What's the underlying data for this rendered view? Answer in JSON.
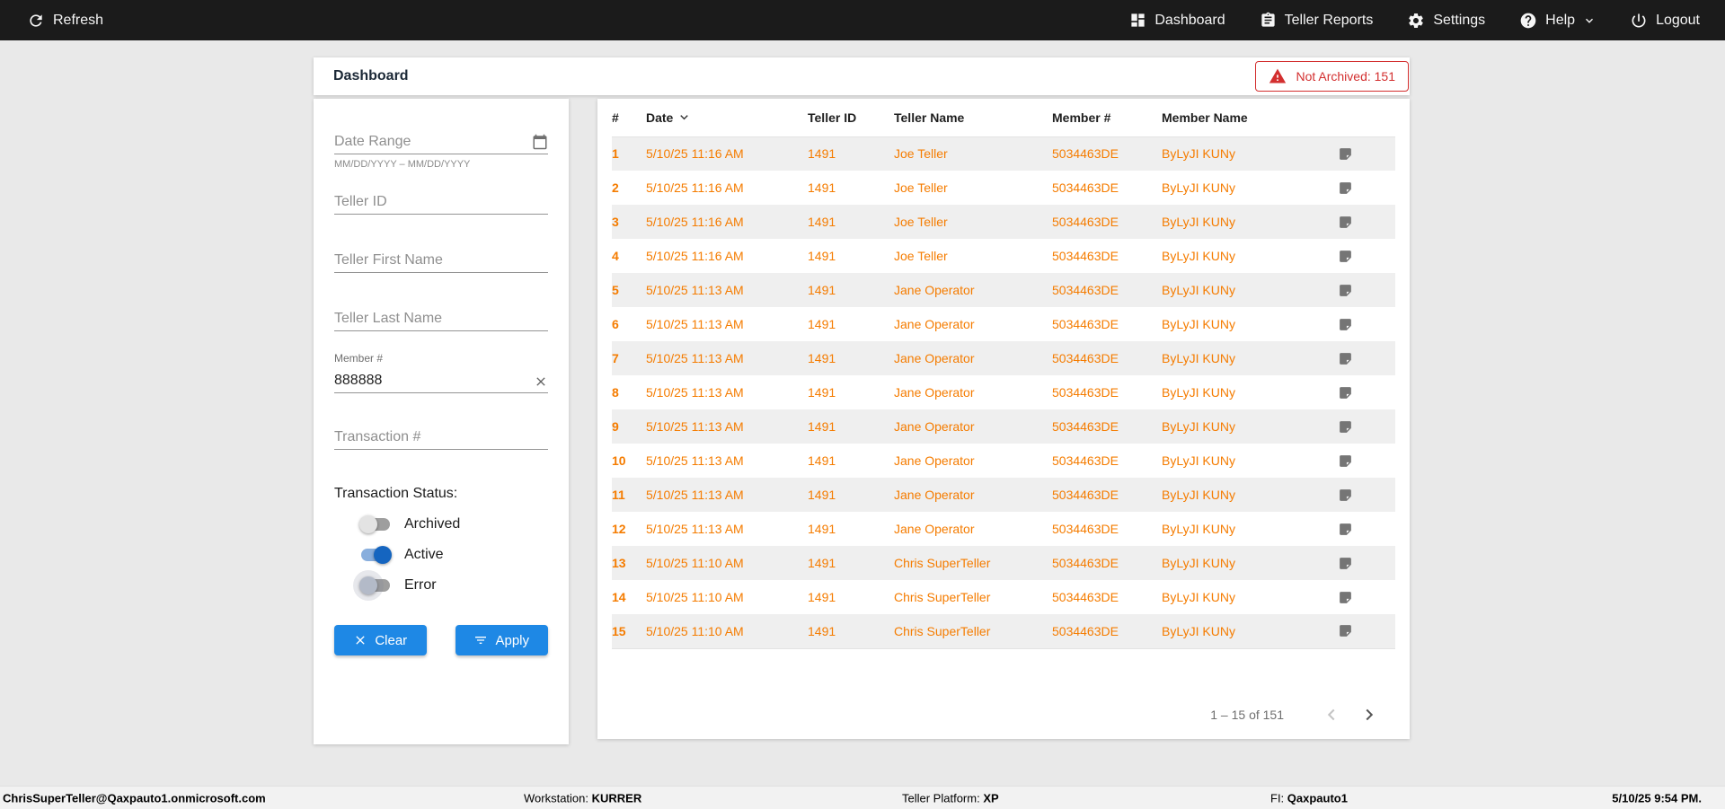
{
  "topbar": {
    "refresh_label": "Refresh",
    "nav": [
      {
        "label": "Dashboard",
        "icon": "dashboard-icon"
      },
      {
        "label": "Teller Reports",
        "icon": "teller-reports-icon"
      },
      {
        "label": "Settings",
        "icon": "gear-icon"
      },
      {
        "label": "Help",
        "icon": "help-icon"
      },
      {
        "label": "Logout",
        "icon": "power-icon"
      }
    ]
  },
  "header": {
    "title": "Dashboard",
    "not_archived": "Not Archived: 151"
  },
  "filters": {
    "date_range_placeholder": "Date Range",
    "date_range_hint": "MM/DD/YYYY – MM/DD/YYYY",
    "teller_id_placeholder": "Teller ID",
    "teller_first_name_placeholder": "Teller First Name",
    "teller_last_name_placeholder": "Teller Last Name",
    "member_number_label": "Member #",
    "member_number_value": "888888",
    "transaction_number_placeholder": "Transaction #",
    "status_label": "Transaction Status:",
    "toggles": [
      {
        "label": "Archived",
        "on": false
      },
      {
        "label": "Active",
        "on": true
      },
      {
        "label": "Error",
        "on": false
      }
    ],
    "clear_label": "Clear",
    "apply_label": "Apply"
  },
  "table": {
    "columns": [
      "#",
      "Date",
      "Teller ID",
      "Teller Name",
      "Member #",
      "Member Name"
    ],
    "rows": [
      {
        "num": "1",
        "date": "5/10/25 11:16 AM",
        "teller_id": "1491",
        "teller_name": "Joe Teller",
        "member_number": "5034463DE",
        "member_name": "ByLyJI KUNy"
      },
      {
        "num": "2",
        "date": "5/10/25 11:16 AM",
        "teller_id": "1491",
        "teller_name": "Joe Teller",
        "member_number": "5034463DE",
        "member_name": "ByLyJI KUNy"
      },
      {
        "num": "3",
        "date": "5/10/25 11:16 AM",
        "teller_id": "1491",
        "teller_name": "Joe Teller",
        "member_number": "5034463DE",
        "member_name": "ByLyJI KUNy"
      },
      {
        "num": "4",
        "date": "5/10/25 11:16 AM",
        "teller_id": "1491",
        "teller_name": "Joe Teller",
        "member_number": "5034463DE",
        "member_name": "ByLyJI KUNy"
      },
      {
        "num": "5",
        "date": "5/10/25 11:13 AM",
        "teller_id": "1491",
        "teller_name": "Jane Operator",
        "member_number": "5034463DE",
        "member_name": "ByLyJI KUNy"
      },
      {
        "num": "6",
        "date": "5/10/25 11:13 AM",
        "teller_id": "1491",
        "teller_name": "Jane Operator",
        "member_number": "5034463DE",
        "member_name": "ByLyJI KUNy"
      },
      {
        "num": "7",
        "date": "5/10/25 11:13 AM",
        "teller_id": "1491",
        "teller_name": "Jane Operator",
        "member_number": "5034463DE",
        "member_name": "ByLyJI KUNy"
      },
      {
        "num": "8",
        "date": "5/10/25 11:13 AM",
        "teller_id": "1491",
        "teller_name": "Jane Operator",
        "member_number": "5034463DE",
        "member_name": "ByLyJI KUNy"
      },
      {
        "num": "9",
        "date": "5/10/25 11:13 AM",
        "teller_id": "1491",
        "teller_name": "Jane Operator",
        "member_number": "5034463DE",
        "member_name": "ByLyJI KUNy"
      },
      {
        "num": "10",
        "date": "5/10/25 11:13 AM",
        "teller_id": "1491",
        "teller_name": "Jane Operator",
        "member_number": "5034463DE",
        "member_name": "ByLyJI KUNy"
      },
      {
        "num": "11",
        "date": "5/10/25 11:13 AM",
        "teller_id": "1491",
        "teller_name": "Jane Operator",
        "member_number": "5034463DE",
        "member_name": "ByLyJI KUNy"
      },
      {
        "num": "12",
        "date": "5/10/25 11:13 AM",
        "teller_id": "1491",
        "teller_name": "Jane Operator",
        "member_number": "5034463DE",
        "member_name": "ByLyJI KUNy"
      },
      {
        "num": "13",
        "date": "5/10/25 11:10 AM",
        "teller_id": "1491",
        "teller_name": "Chris SuperTeller",
        "member_number": "5034463DE",
        "member_name": "ByLyJI KUNy"
      },
      {
        "num": "14",
        "date": "5/10/25 11:10 AM",
        "teller_id": "1491",
        "teller_name": "Chris SuperTeller",
        "member_number": "5034463DE",
        "member_name": "ByLyJI KUNy"
      },
      {
        "num": "15",
        "date": "5/10/25 11:10 AM",
        "teller_id": "1491",
        "teller_name": "Chris SuperTeller",
        "member_number": "5034463DE",
        "member_name": "ByLyJI KUNy"
      }
    ],
    "pagination": "1 – 15 of 151"
  },
  "statusbar": {
    "user": "ChrisSuperTeller@Qaxpauto1.onmicrosoft.com",
    "workstation_label": "Workstation: ",
    "workstation_value": "KURRER",
    "platform_label": "Teller Platform: ",
    "platform_value": "XP",
    "fi_label": "FI: ",
    "fi_value": "Qaxpauto1",
    "datetime": "5/10/25 9:54 PM."
  },
  "colors": {
    "accent_blue": "#1E88E5",
    "row_orange": "#F57C00",
    "alert_red": "#D32F2F",
    "toggle_on_blue": "#1565C0"
  }
}
